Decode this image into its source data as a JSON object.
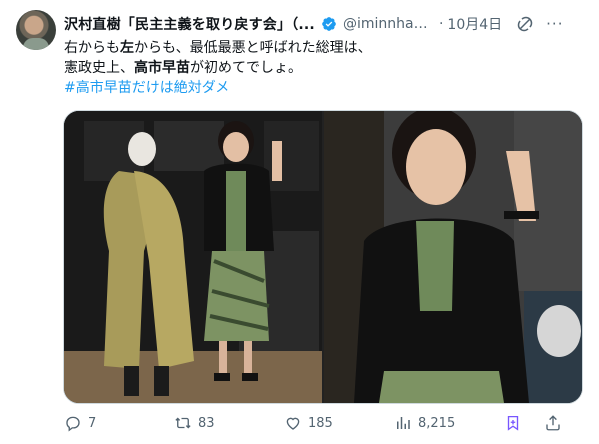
{
  "tweet": {
    "author_name": "沢村直樹「民主主義を取り戻す会」（...",
    "handle": "@iminnhan...",
    "separator": "·",
    "date": "10月4日",
    "text_line1_a": "右からも",
    "text_line1_b": "左",
    "text_line1_c": "からも、最低最悪と呼ばれた総理は、",
    "text_line2_a": "憲政史上、",
    "text_line2_b": "高市早苗",
    "text_line2_c": "が初めてでしょ。",
    "hashtag": "#高市早苗だけは絶対ダメ"
  },
  "icons": {
    "verified": "verified-badge-icon",
    "grok": "grok-icon",
    "more": "more-icon",
    "reply": "reply-icon",
    "retweet": "retweet-icon",
    "like": "like-icon",
    "views": "views-icon",
    "bookmark": "bookmark-icon",
    "share": "share-icon"
  },
  "actions": {
    "replies": "7",
    "retweets": "83",
    "likes": "185",
    "views": "8,215"
  },
  "colors": {
    "accent": "#1d9bf0",
    "secondary_text": "#536471",
    "bookmark_active": "#7856ff"
  }
}
